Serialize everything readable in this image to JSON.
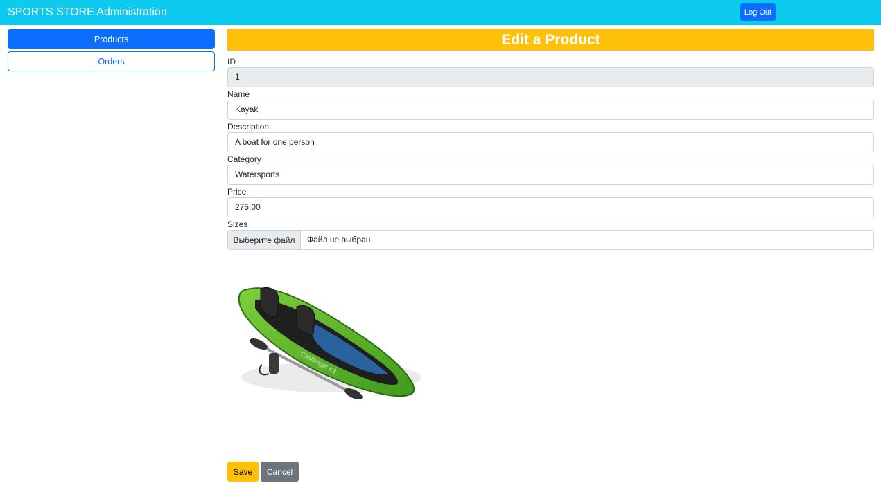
{
  "header": {
    "brand": "SPORTS STORE Administration",
    "logout_label": "Log Out"
  },
  "sidebar": {
    "items": [
      {
        "label": "Products",
        "active": true
      },
      {
        "label": "Orders",
        "active": false
      }
    ]
  },
  "form": {
    "title": "Edit a Product",
    "fields": {
      "id": {
        "label": "ID",
        "value": "1"
      },
      "name": {
        "label": "Name",
        "value": "Kayak"
      },
      "description": {
        "label": "Description",
        "value": "A boat for one person"
      },
      "category": {
        "label": "Category",
        "value": "Watersports"
      },
      "price": {
        "label": "Price",
        "value": "275,00"
      },
      "sizes": {
        "label": "Sizes",
        "button_label": "Выберите файл",
        "status": "Файл не выбран"
      }
    },
    "image": {
      "icon": "kayak-image"
    },
    "save_label": "Save",
    "cancel_label": "Cancel"
  },
  "colors": {
    "navbar": "#0dcaf0",
    "primary": "#0d6efd",
    "warning": "#ffc107",
    "secondary": "#6c757d"
  }
}
